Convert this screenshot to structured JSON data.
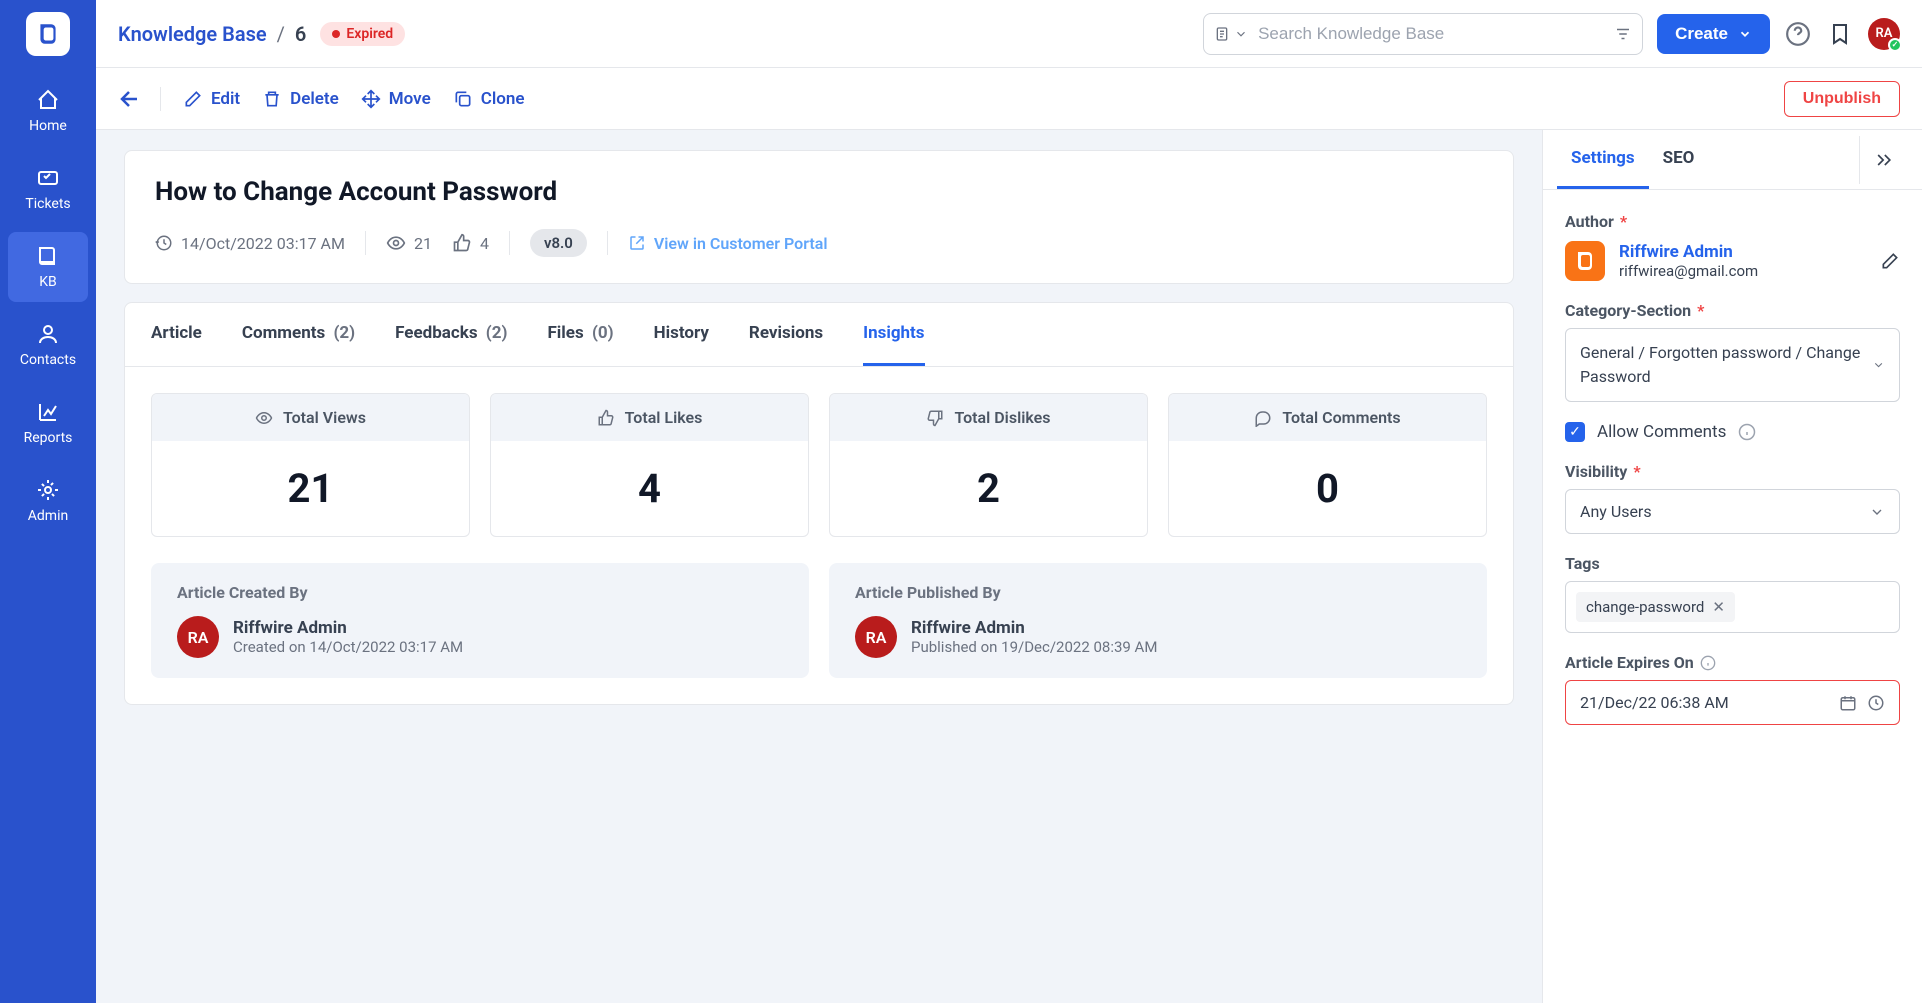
{
  "sidebar": {
    "items": [
      {
        "label": "Home"
      },
      {
        "label": "Tickets"
      },
      {
        "label": "KB"
      },
      {
        "label": "Contacts"
      },
      {
        "label": "Reports"
      },
      {
        "label": "Admin"
      }
    ]
  },
  "topbar": {
    "breadcrumb_kb": "Knowledge Base",
    "breadcrumb_slash": "/",
    "breadcrumb_id": "6",
    "status": "Expired",
    "search_placeholder": "Search Knowledge Base",
    "create_label": "Create",
    "avatar_initials": "RA"
  },
  "actions": {
    "edit": "Edit",
    "delete": "Delete",
    "move": "Move",
    "clone": "Clone",
    "unpublish": "Unpublish"
  },
  "article": {
    "title": "How to Change Account Password",
    "date": "14/Oct/2022 03:17 AM",
    "views": "21",
    "likes": "4",
    "version": "v8.0",
    "portal_link": "View in Customer Portal"
  },
  "tabs": {
    "article": "Article",
    "comments": "Comments",
    "comments_count": "(2)",
    "feedbacks": "Feedbacks",
    "feedbacks_count": "(2)",
    "files": "Files",
    "files_count": "(0)",
    "history": "History",
    "revisions": "Revisions",
    "insights": "Insights"
  },
  "insights": {
    "views_label": "Total Views",
    "views_value": "21",
    "likes_label": "Total Likes",
    "likes_value": "4",
    "dislikes_label": "Total Dislikes",
    "dislikes_value": "2",
    "comments_label": "Total Comments",
    "comments_value": "0",
    "created_heading": "Article Created By",
    "created_name": "Riffwire Admin",
    "created_sub": "Created on 14/Oct/2022 03:17 AM",
    "created_initials": "RA",
    "published_heading": "Article Published By",
    "published_name": "Riffwire Admin",
    "published_sub": "Published on 19/Dec/2022 08:39 AM",
    "published_initials": "RA"
  },
  "panel": {
    "settings_tab": "Settings",
    "seo_tab": "SEO",
    "author_label": "Author",
    "author_name": "Riffwire Admin",
    "author_email": "riffwirea@gmail.com",
    "category_label": "Category-Section",
    "category_value": "General / Forgotten password / Change Password",
    "allow_comments": "Allow Comments",
    "visibility_label": "Visibility",
    "visibility_value": "Any Users",
    "tags_label": "Tags",
    "tag_value": "change-password",
    "expires_label": "Article Expires On",
    "expires_value": "21/Dec/22 06:38 AM"
  }
}
